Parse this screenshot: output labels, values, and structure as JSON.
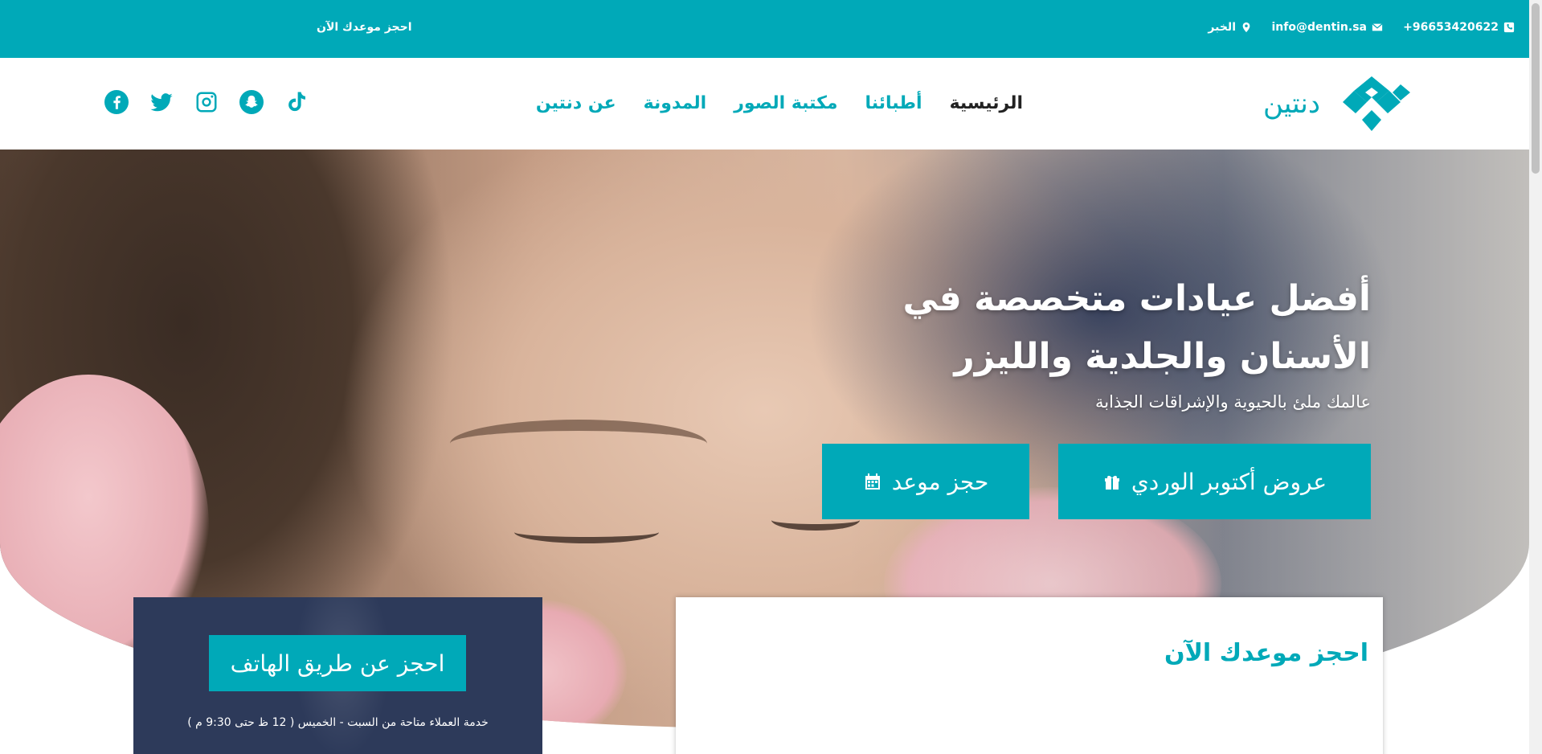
{
  "topbar": {
    "phone": "+96653420622",
    "email": "info@dentin.sa",
    "city": "الخبر",
    "book_now": "احجز موعدك الآن"
  },
  "header": {
    "logo_text": "دنتين",
    "nav": [
      {
        "label": "الرئيسية",
        "active": true
      },
      {
        "label": "أطبائنا",
        "active": false
      },
      {
        "label": "مكتبة الصور",
        "active": false
      },
      {
        "label": "المدونة",
        "active": false
      },
      {
        "label": "عن دنتين",
        "active": false
      }
    ],
    "social_icons": [
      "tiktok-icon",
      "snapchat-icon",
      "instagram-icon",
      "twitter-icon",
      "facebook-icon"
    ]
  },
  "hero": {
    "title_line1": "أفضل عيادات متخصصة في",
    "title_line2": "الأسنان والجلدية والليزر",
    "subtitle": "عالمك ملئ بالحيوية والإشراقات الجذابة",
    "offers_button": "عروض أكتوبر الوردي",
    "book_button": "حجز موعد"
  },
  "booking_form": {
    "title": "احجز موعدك الآن"
  },
  "phone_card": {
    "button": "احجز عن طريق الهاتف",
    "note": "خدمة العملاء متاحة من السبت - الخميس ( 12 ظ حتى 9:30 م )"
  },
  "colors": {
    "accent": "#00a9b8",
    "dark_card": "#2d3a5a",
    "nav_active": "#222222"
  }
}
